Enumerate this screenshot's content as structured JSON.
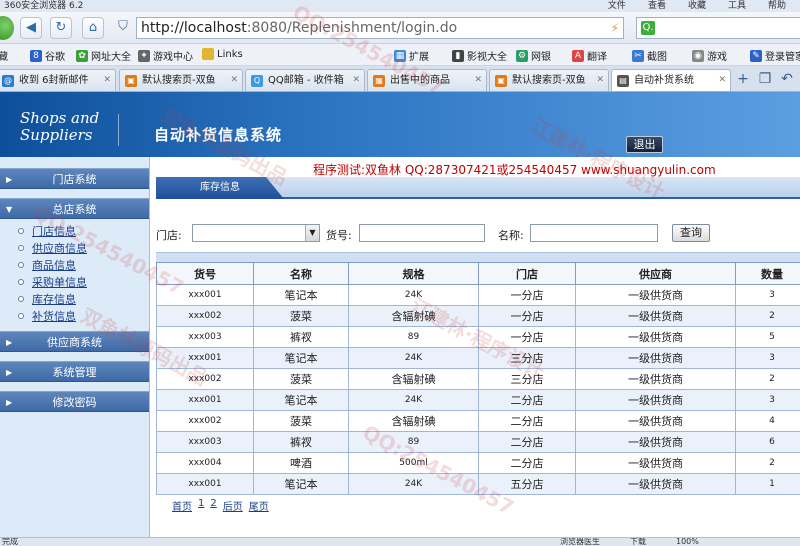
{
  "browser": {
    "title": "360安全浏览器 6.2",
    "menus": [
      "文件",
      "查看",
      "收藏",
      "工具",
      "帮助"
    ],
    "url_host": "http://localhost",
    "url_path": ":8080/Replenishment/login.do",
    "search_prefix": "Q."
  },
  "bookmarks": [
    {
      "icon": "music-icon",
      "label": "藏"
    },
    {
      "icon": "baidu-icon",
      "label": "谷歌"
    },
    {
      "icon": "globe-icon",
      "label": "网址大全"
    },
    {
      "icon": "gamepad-icon",
      "label": "游戏中心"
    },
    {
      "icon": "folder-icon",
      "label": "Links"
    },
    {
      "icon": "puzzle-icon",
      "label": "扩展"
    },
    {
      "icon": "film-icon",
      "label": "影视大全"
    },
    {
      "icon": "bank-icon",
      "label": "网银"
    },
    {
      "icon": "translate-icon",
      "label": "翻译"
    },
    {
      "icon": "screenshot-icon",
      "label": "截图"
    },
    {
      "icon": "game-icon",
      "label": "游戏"
    },
    {
      "icon": "key-icon",
      "label": "登录管家"
    }
  ],
  "tabs": [
    {
      "label": "收到 6封新邮件",
      "color": "#2a7bd0"
    },
    {
      "label": "默认搜索页-双鱼",
      "color": "#e07b1a"
    },
    {
      "label": "QQ邮箱 - 收件箱",
      "color": "#3a9be0"
    },
    {
      "label": "出售中的商品",
      "color": "#e07b1a"
    },
    {
      "label": "默认搜索页-双鱼",
      "color": "#e07b1a"
    },
    {
      "label": "自动补货系统",
      "color": "#555555"
    }
  ],
  "header": {
    "brand": "Shops and Suppliers",
    "title": "自动补货信息系统",
    "logout_label": "退出"
  },
  "sidebar": {
    "sections": [
      {
        "label": "门店系统",
        "items": []
      },
      {
        "label": "总店系统",
        "items": [
          "门店信息",
          "供应商信息",
          "商品信息",
          "采购单信息",
          "库存信息",
          "补货信息"
        ]
      },
      {
        "label": "供应商系统",
        "items": []
      },
      {
        "label": "系统管理",
        "items": []
      },
      {
        "label": "修改密码",
        "items": []
      }
    ]
  },
  "main": {
    "contact": "程序测试:双鱼林 QQ:287307421或254540457 www.shuangyulin.com",
    "breadcrumb": "库存信息",
    "filters": {
      "store_label": "门店:",
      "goods_no_label": "货号:",
      "name_label": "名称:",
      "query_label": "查询"
    },
    "table": {
      "headers": [
        "货号",
        "名称",
        "规格",
        "门店",
        "供应商",
        "数量"
      ],
      "rows": [
        [
          "xxx001",
          "笔记本",
          "24K",
          "一分店",
          "一级供货商",
          "3"
        ],
        [
          "xxx002",
          "菠菜",
          "含辐射碘",
          "一分店",
          "一级供货商",
          "2"
        ],
        [
          "xxx003",
          "裤衩",
          "89",
          "一分店",
          "一级供货商",
          "5"
        ],
        [
          "xxx001",
          "笔记本",
          "24K",
          "三分店",
          "一级供货商",
          "3"
        ],
        [
          "xxx002",
          "菠菜",
          "含辐射碘",
          "三分店",
          "一级供货商",
          "2"
        ],
        [
          "xxx001",
          "笔记本",
          "24K",
          "二分店",
          "一级供货商",
          "3"
        ],
        [
          "xxx002",
          "菠菜",
          "含辐射碘",
          "二分店",
          "一级供货商",
          "4"
        ],
        [
          "xxx003",
          "裤衩",
          "89",
          "二分店",
          "一级供货商",
          "6"
        ],
        [
          "xxx004",
          "啤酒",
          "500ml",
          "二分店",
          "一级供货商",
          "2"
        ],
        [
          "xxx001",
          "笔记本",
          "24K",
          "五分店",
          "一级供货商",
          "1"
        ]
      ]
    },
    "pager": [
      "首页",
      "1",
      "2",
      "后页",
      "尾页"
    ]
  },
  "status": {
    "left": "完成",
    "items": [
      "浏览器医生",
      "下载",
      "100%"
    ]
  },
  "watermarks": [
    "QQ:254540457",
    "双鱼林源码出品",
    "江建林·程序设计",
    "QQ:254540457",
    "双鱼林源码出品",
    "江建林·程序设计",
    "QQ:254540457"
  ]
}
